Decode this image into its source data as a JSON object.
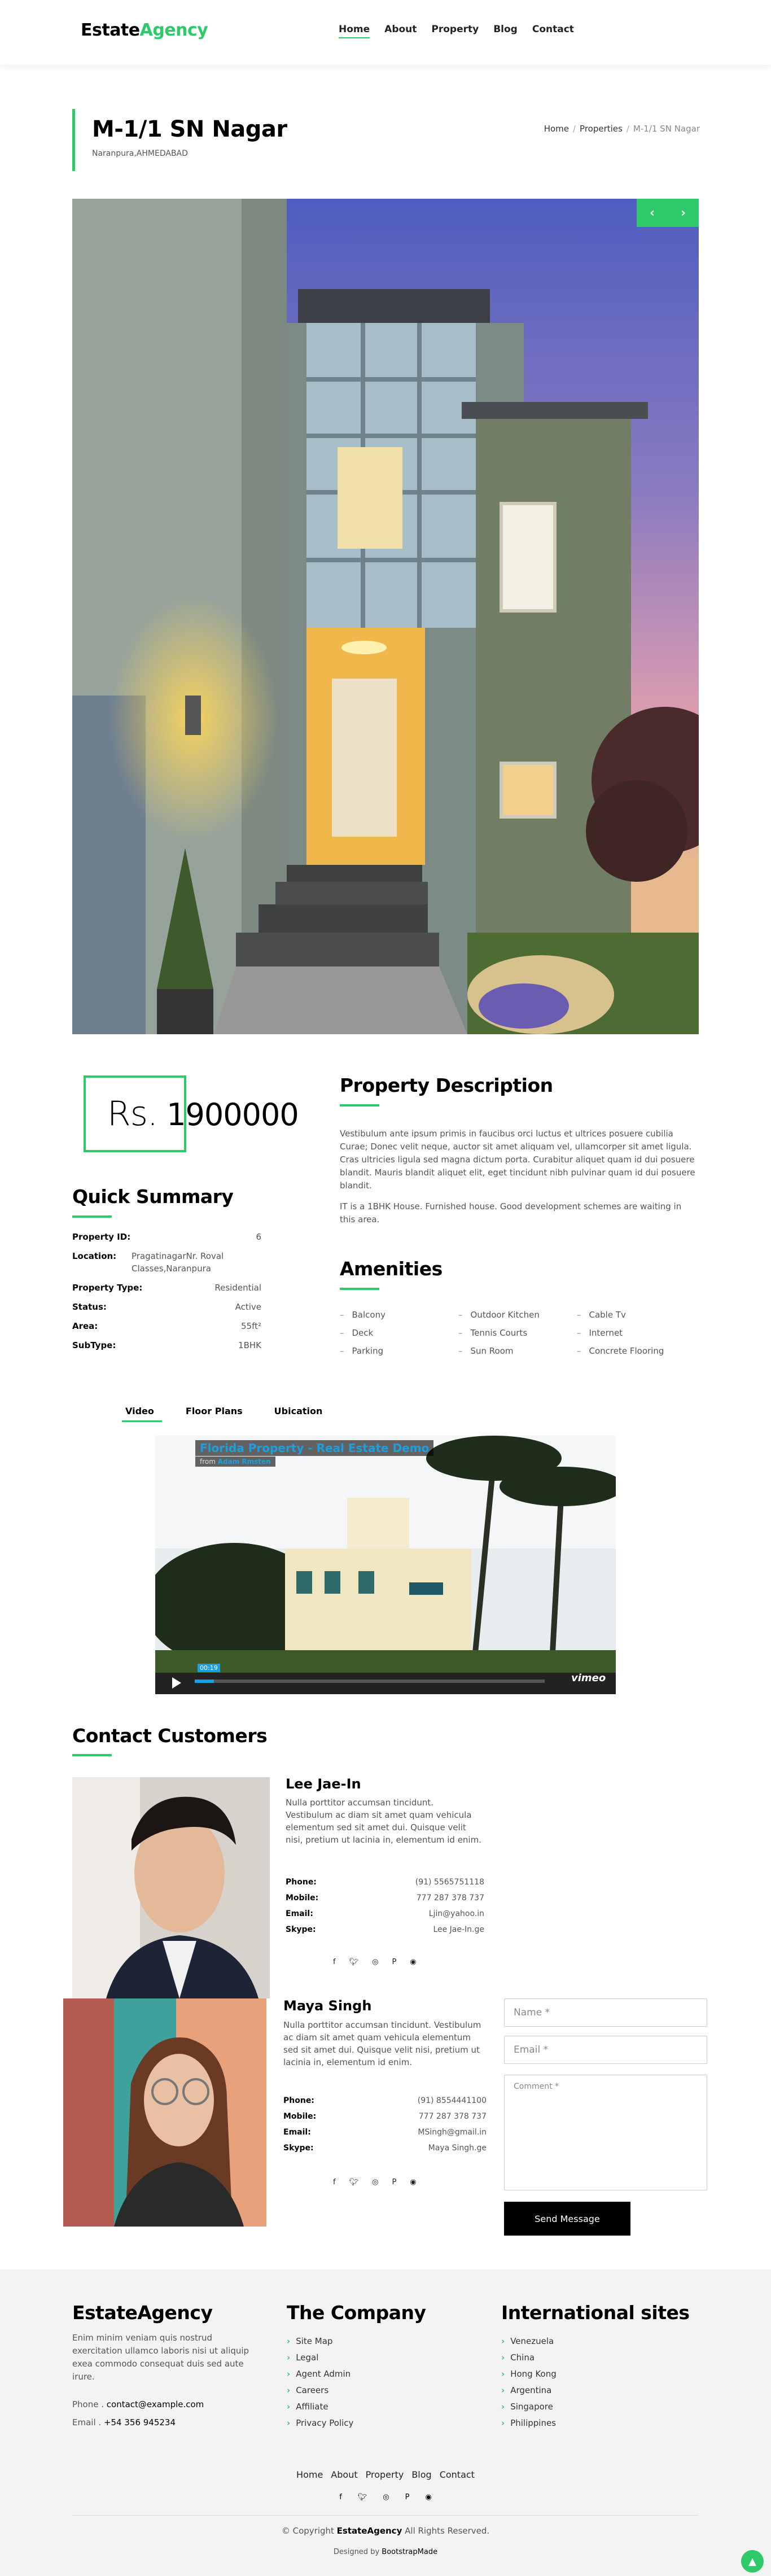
{
  "nav": {
    "brand_a": "Estate",
    "brand_b": "Agency",
    "items": [
      "Home",
      "About",
      "Property",
      "Blog",
      "Contact"
    ]
  },
  "title": {
    "name": "M-1/1 SN Nagar",
    "location": "Naranpura,AHMEDABAD",
    "breadcrumb": [
      "Home",
      "Properties",
      "M-1/1 SN Nagar"
    ]
  },
  "hero": {
    "prev": "‹",
    "next": "›"
  },
  "price": {
    "currency": "Rs.",
    "amount": "1900000"
  },
  "summary": {
    "heading": "Quick Summary",
    "rows": [
      {
        "k": "Property ID:",
        "v": "6"
      },
      {
        "k": "Location:",
        "v": "PragatinagarNr. Roval Classes,Naranpura"
      },
      {
        "k": "Property Type:",
        "v": "Residential"
      },
      {
        "k": "Status:",
        "v": "Active"
      },
      {
        "k": "Area:",
        "v": "55ft²"
      },
      {
        "k": "SubType:",
        "v": "1BHK"
      }
    ]
  },
  "description": {
    "heading": "Property Description",
    "p1": "Vestibulum ante ipsum primis in faucibus orci luctus et ultrices posuere cubilia Curae; Donec velit neque, auctor sit amet aliquam vel, ullamcorper sit amet ligula. Cras ultricies ligula sed magna dictum porta. Curabitur aliquet quam id dui posuere blandit. Mauris blandit aliquet elit, eget tincidunt nibh pulvinar quam id dui posuere blandit.",
    "p2": "IT is a 1BHK House. Furnished house. Good development schemes are waiting in this area."
  },
  "amenities": {
    "heading": "Amenities",
    "items": [
      "Balcony",
      "Outdoor Kitchen",
      "Cable Tv",
      "Deck",
      "Tennis Courts",
      "Internet",
      "Parking",
      "Sun Room",
      "Concrete Flooring"
    ]
  },
  "tabs": [
    "Video",
    "Floor Plans",
    "Ubication"
  ],
  "video": {
    "title": "Florida Property - Real Estate Demo",
    "from_prefix": "from",
    "from_name": "Adam Rmsten",
    "time": "00:19",
    "brand": "vimeo"
  },
  "contact": {
    "heading": "Contact Customers",
    "agents": [
      {
        "name": "Lee Jae-In",
        "bio": "Nulla porttitor accumsan tincidunt. Vestibulum ac diam sit amet quam vehicula elementum sed sit amet dui. Quisque velit nisi, pretium ut lacinia in, elementum id enim.",
        "phone": "(91) 5565751118",
        "mobile": "777 287 378 737",
        "email": "Ljin@yahoo.in",
        "skype": "Lee Jae-In.ge"
      },
      {
        "name": "Maya Singh",
        "bio": "Nulla porttitor accumsan tincidunt. Vestibulum ac diam sit amet quam vehicula elementum sed sit amet dui. Quisque velit nisi, pretium ut lacinia in, elementum id enim.",
        "phone": "(91) 8554441100",
        "mobile": "777 287 378 737",
        "email": "MSingh@gmail.in",
        "skype": "Maya Singh.ge"
      }
    ],
    "labels": {
      "phone": "Phone:",
      "mobile": "Mobile:",
      "email": "Email:",
      "skype": "Skype:"
    },
    "form": {
      "name_placeholder": "Name *",
      "email_placeholder": "Email *",
      "comment_placeholder": "Comment *",
      "send": "Send Message"
    }
  },
  "footer": {
    "col1": {
      "brand": "EstateAgency",
      "text": "Enim minim veniam quis nostrud exercitation ullamco laboris nisi ut aliquip exea commodo consequat duis sed aute irure.",
      "phone_label": "Phone .",
      "phone": "contact@example.com",
      "email_label": "Email .",
      "email": "+54 356 945234"
    },
    "col2": {
      "heading": "The Company",
      "links": [
        "Site Map",
        "Legal",
        "Agent Admin",
        "Careers",
        "Affiliate",
        "Privacy Policy"
      ]
    },
    "col3": {
      "heading": "International sites",
      "links": [
        "Venezuela",
        "China",
        "Hong Kong",
        "Argentina",
        "Singapore",
        "Philippines"
      ]
    },
    "nav": [
      "Home",
      "About",
      "Property",
      "Blog",
      "Contact"
    ],
    "copy_prefix": "© Copyright",
    "copy_brand": "EstateAgency",
    "copy_suffix": "All Rights Reserved.",
    "designed_prefix": "Designed by",
    "designed_by": "BootstrapMade"
  },
  "colors": {
    "accent": "#2eca6a"
  }
}
